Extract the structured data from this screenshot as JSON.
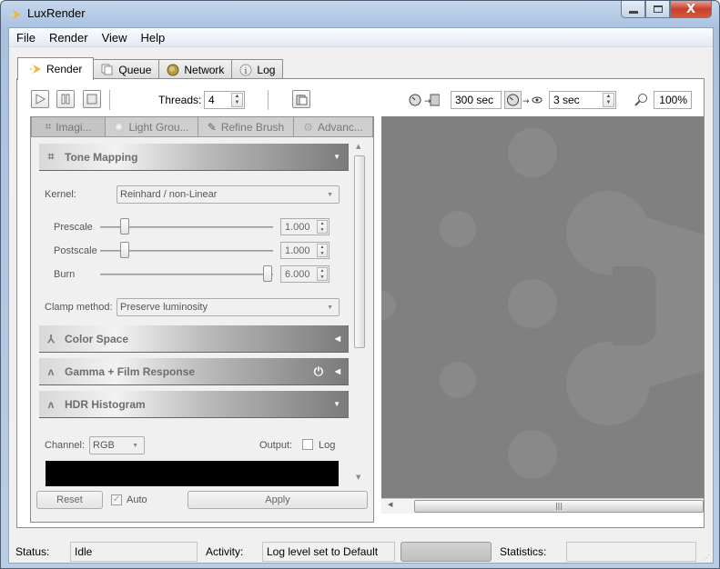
{
  "window": {
    "title": "LuxRender",
    "controls": {
      "minimize": "–",
      "maximize": "□",
      "close": "X"
    }
  },
  "menubar": [
    "File",
    "Render",
    "View",
    "Help"
  ],
  "tabs": [
    {
      "label": "Render",
      "icon": "render-icon",
      "active": true
    },
    {
      "label": "Queue",
      "icon": "queue-icon",
      "active": false
    },
    {
      "label": "Network",
      "icon": "network-icon",
      "active": false
    },
    {
      "label": "Log",
      "icon": "info-icon",
      "active": false
    }
  ],
  "toolbar": {
    "threads_label": "Threads:",
    "threads_value": "4",
    "halt_time_value": "300 sec",
    "display_interval_value": "3 sec",
    "zoom_value": "100%"
  },
  "subtabs": [
    {
      "label": "Imagi...",
      "icon": "crop-icon",
      "active": true
    },
    {
      "label": "Light Grou...",
      "icon": "bulb-icon",
      "active": false
    },
    {
      "label": "Refine Brush",
      "icon": "brush-icon",
      "active": false
    },
    {
      "label": "Advanc...",
      "icon": "gear-icon",
      "active": false
    }
  ],
  "tone_mapping": {
    "title": "Tone Mapping",
    "kernel_label": "Kernel:",
    "kernel_value": "Reinhard / non-Linear",
    "sliders": [
      {
        "label": "Prescale",
        "value": "1.000",
        "position": 0.14
      },
      {
        "label": "Postscale",
        "value": "1.000",
        "position": 0.14
      },
      {
        "label": "Burn",
        "value": "6.000",
        "position": 0.97
      }
    ],
    "clamp_label": "Clamp method:",
    "clamp_value": "Preserve luminosity"
  },
  "sections": {
    "color_space": "Color Space",
    "gamma": "Gamma + Film Response",
    "histogram": "HDR Histogram"
  },
  "histogram": {
    "channel_label": "Channel:",
    "channel_value": "RGB",
    "output_label": "Output:",
    "log_label": "Log",
    "log_checked": false
  },
  "footer": {
    "reset_label": "Reset",
    "auto_label": "Auto",
    "auto_checked": true,
    "apply_label": "Apply"
  },
  "statusbar": {
    "status_label": "Status:",
    "status_value": "Idle",
    "activity_label": "Activity:",
    "activity_value": "Log level set to Default",
    "statistics_label": "Statistics:",
    "statistics_value": ""
  },
  "colors": {
    "render_bg": "#808080",
    "render_shapes": "#8a8a8a",
    "histogram_bg": "#000000"
  }
}
